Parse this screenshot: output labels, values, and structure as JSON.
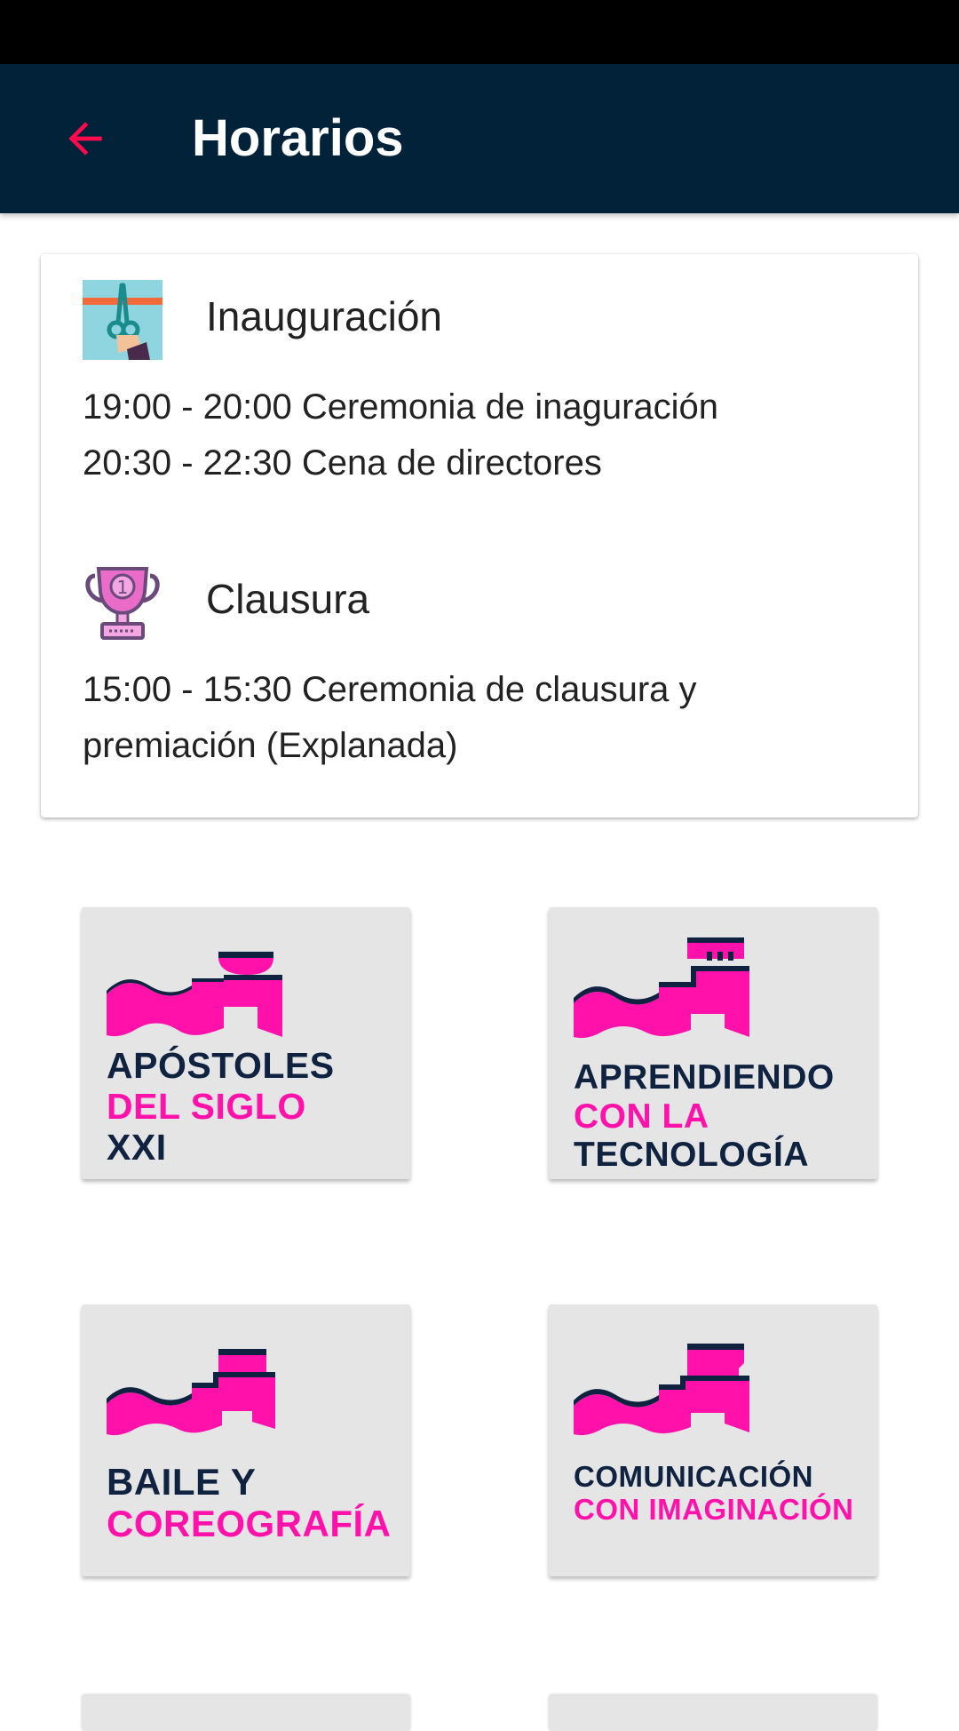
{
  "app_bar": {
    "title": "Horarios",
    "back_icon": "arrow-back-icon",
    "accent": "#ff0a4e",
    "background": "#02223a"
  },
  "card": {
    "sections": [
      {
        "title": "Inauguración",
        "icon": "ribbon-cutting-icon",
        "lines": [
          "19:00 - 20:00 Ceremonia de inaguración",
          "20:30 - 22:30 Cena de directores"
        ]
      },
      {
        "title": "Clausura",
        "icon": "trophy-icon",
        "lines": [
          "15:00 - 15:30 Ceremonia de clausura y",
          "premiación (Explanada)"
        ]
      }
    ]
  },
  "tiles": [
    {
      "lines": [
        {
          "text": "APÓSTOLES",
          "color": "dark"
        },
        {
          "text": "DEL SIGLO",
          "color": "pink"
        },
        {
          "text": "XXI",
          "color": "dark"
        }
      ]
    },
    {
      "lines": [
        {
          "text": "APRENDIENDO",
          "color": "dark"
        },
        {
          "text": "CON LA",
          "color": "pink"
        },
        {
          "text": "TECNOLOGÍA",
          "color": "dark"
        }
      ]
    },
    {
      "lines": [
        {
          "text": "BAILE Y",
          "color": "dark"
        },
        {
          "text": "COREOGRAFÍA",
          "color": "pink"
        }
      ]
    },
    {
      "lines": [
        {
          "text": "COMUNICACIÓN",
          "color": "dark"
        },
        {
          "text": "CON IMAGINACIÓN",
          "color": "pink"
        }
      ]
    }
  ],
  "colors": {
    "pink": "#ff11aa",
    "navy": "#0f2340",
    "tile_bg": "#e6e5e6"
  }
}
